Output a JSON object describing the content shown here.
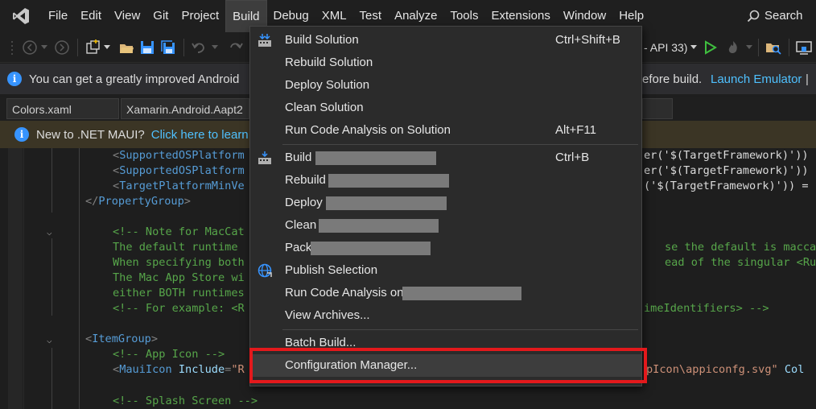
{
  "menubar": {
    "items": [
      "File",
      "Edit",
      "View",
      "Git",
      "Project",
      "Build",
      "Debug",
      "XML",
      "Test",
      "Analyze",
      "Tools",
      "Extensions",
      "Window",
      "Help"
    ],
    "active": "Build",
    "search_label": "Search"
  },
  "toolbar": {
    "target_text": "- API 33)",
    "target_dropdown_icon": "chevron-down-icon",
    "run_icon": "play-icon"
  },
  "infobar_android": {
    "text_left": "You can get a greatly improved Android",
    "text_right": "efore build.",
    "link": "Launch Emulator",
    "separator": "|"
  },
  "tabs": [
    {
      "label": "Colors.xaml"
    },
    {
      "label": "Xamarin.Android.Aapt2"
    }
  ],
  "infobar_maui": {
    "text": "New to .NET MAUI?",
    "link": "Click here to learn"
  },
  "code": {
    "line1_tag": "SupportedOSPlatform",
    "line1_right": "er('$(TargetFramework)'))",
    "line2_tag": "SupportedOSPlatform",
    "line2_right": "er('$(TargetFramework)'))",
    "line3_tag": "TargetPlatformMinVe",
    "line3_right": "('$(TargetFramework)')) =",
    "line4_close": "PropertyGroup",
    "c1": "<!-- Note for MacCat",
    "c2": "The default runtime",
    "c2_right": "se the default is maccata",
    "c3": "When specifying both",
    "c3_right": "ead of the singular <Runti",
    "c4": "The Mac App Store wi",
    "c5": "either BOTH runtimes",
    "c6": "<!-- For example: <R",
    "c6_right": "imeIdentifiers> -->",
    "itemgroup": "ItemGroup",
    "app_icon_comment": "<!-- App Icon -->",
    "maui_icon_tag": "MauiIcon",
    "include_attr": "Include",
    "include_val_start": "\"R",
    "maui_icon_right_str": "pIcon\\appiconfg.svg\"",
    "maui_icon_right_attr": "Col",
    "splash_comment": "<!-- Splash Screen -->"
  },
  "build_menu": {
    "items": [
      {
        "label": "Build Solution",
        "shortcut": "Ctrl+Shift+B",
        "icon": "build-solution-icon"
      },
      {
        "label": "Rebuild Solution",
        "shortcut": ""
      },
      {
        "label": "Deploy Solution",
        "shortcut": ""
      },
      {
        "label": "Clean Solution",
        "shortcut": ""
      },
      {
        "label": "Run Code Analysis on Solution",
        "shortcut": "Alt+F11"
      },
      {
        "label": "Build",
        "shortcut": "Ctrl+B",
        "icon": "build-project-icon",
        "redacted": true
      },
      {
        "label": "Rebuild",
        "shortcut": "",
        "redacted": true
      },
      {
        "label": "Deploy",
        "shortcut": "",
        "redacted": true
      },
      {
        "label": "Clean",
        "shortcut": "",
        "redacted": true
      },
      {
        "label": "Pack",
        "shortcut": "",
        "redacted": true
      },
      {
        "label": "Publish Selection",
        "shortcut": "",
        "icon": "publish-globe-icon"
      },
      {
        "label": "Run Code Analysis on",
        "shortcut": "",
        "redacted": true
      },
      {
        "label": "View Archives...",
        "shortcut": ""
      },
      {
        "label": "Batch Build...",
        "shortcut": ""
      },
      {
        "label": "Configuration Manager...",
        "shortcut": "",
        "highlighted": true
      }
    ]
  },
  "colors": {
    "accent_highlight": "#e3191c",
    "info_blue": "#3794ff",
    "link": "#4fc1ff"
  }
}
